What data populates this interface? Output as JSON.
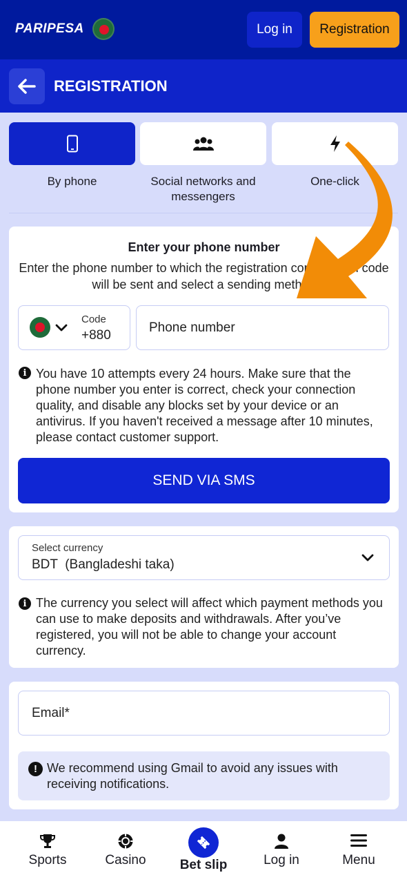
{
  "header": {
    "logo_text": "PARIPESA",
    "login_label": "Log in",
    "register_label": "Registration"
  },
  "page": {
    "title": "REGISTRATION"
  },
  "tabs": [
    {
      "label": "By phone",
      "icon": "smartphone-icon",
      "active": true
    },
    {
      "label": "Social networks and messengers",
      "icon": "users-icon",
      "active": false
    },
    {
      "label": "One-click",
      "icon": "bolt-icon",
      "active": false
    }
  ],
  "phone_section": {
    "title": "Enter your phone number",
    "description": "Enter the phone number to which the registration confirmation code will be sent and select a sending method",
    "code_label": "Code",
    "code_value": "+880",
    "phone_placeholder": "Phone number",
    "info_text": "You have 10 attempts every 24 hours. Make sure that the phone number you enter is correct, check your connection quality, and disable any blocks set by your device or an antivirus. If you haven't received a message after 10 minutes, please contact customer support.",
    "send_button": "SEND VIA SMS"
  },
  "currency_section": {
    "label": "Select currency",
    "value": "BDT  (Bangladeshi taka)",
    "info_text": "The currency you select will affect which payment methods you can use to make deposits and withdrawals. After you’ve registered, you will not be able to change your account currency."
  },
  "email_section": {
    "placeholder": "Email*",
    "note": "We recommend using Gmail to avoid any issues with receiving notifications."
  },
  "bottom_nav": [
    {
      "label": "Sports",
      "icon": "trophy-icon"
    },
    {
      "label": "Casino",
      "icon": "casino-chip-icon"
    },
    {
      "label": "Bet slip",
      "icon": "ticket-icon"
    },
    {
      "label": "Log in",
      "icon": "user-icon"
    },
    {
      "label": "Menu",
      "icon": "menu-icon"
    }
  ],
  "colors": {
    "top_bar": "#001a9e",
    "primary": "#0f24c9",
    "accent": "#f7a01b",
    "background": "#d7dcfb"
  }
}
